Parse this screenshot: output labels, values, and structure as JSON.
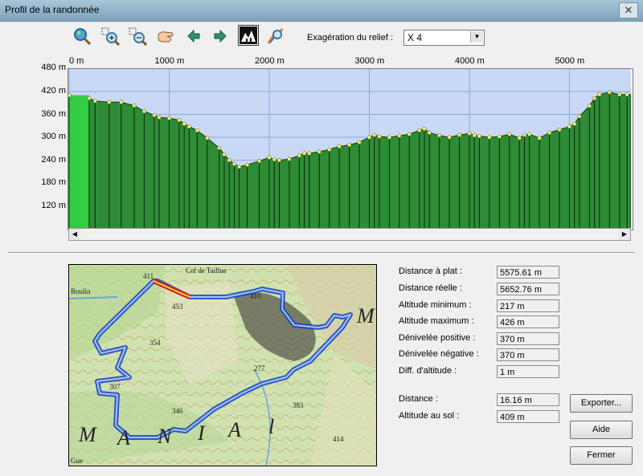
{
  "window": {
    "title": "Profil de la randonnée",
    "close_label": "✕"
  },
  "toolbar": {
    "icons": [
      "zoom-globe-icon",
      "zoom-in-icon",
      "zoom-out-icon",
      "hand-pan-icon",
      "arrow-left-icon",
      "arrow-right-icon",
      "terrain-profile-icon",
      "search-path-icon"
    ],
    "exaggeration_label": "Exagération du relief :",
    "exaggeration_value": "X 4"
  },
  "chart_data": {
    "type": "area",
    "x_ticks": [
      "0 m",
      "1000 m",
      "2000 m",
      "3000 m",
      "4000 m",
      "5000 m"
    ],
    "y_ticks": [
      "480 m",
      "420 m",
      "360 m",
      "300 m",
      "240 m",
      "180 m",
      "120 m"
    ],
    "xlim": [
      0,
      5575
    ],
    "ylim": [
      90,
      500
    ],
    "xlabel": "",
    "ylabel": "",
    "grid": true,
    "colors": {
      "sky": "#c8d8f5",
      "ground": "#2e8b36",
      "ground_start": "#33cc44",
      "grid": "#8ea8dc",
      "point": "#f3ef7a"
    },
    "x": [
      0,
      200,
      260,
      400,
      520,
      650,
      750,
      850,
      900,
      1000,
      1100,
      1150,
      1200,
      1280,
      1380,
      1500,
      1550,
      1600,
      1650,
      1700,
      1780,
      1900,
      2000,
      2050,
      2100,
      2200,
      2300,
      2350,
      2400,
      2500,
      2600,
      2700,
      2800,
      2900,
      3000,
      3050,
      3100,
      3200,
      3300,
      3400,
      3500,
      3550,
      3600,
      3700,
      3800,
      3900,
      4000,
      4050,
      4100,
      4200,
      4300,
      4400,
      4500,
      4550,
      4600,
      4700,
      4800,
      4900,
      5000,
      5050,
      5100,
      5200,
      5250,
      5300,
      5400,
      5500,
      5575
    ],
    "y": [
      410,
      402,
      395,
      392,
      392,
      383,
      368,
      358,
      352,
      350,
      345,
      335,
      328,
      318,
      298,
      272,
      255,
      240,
      230,
      223,
      228,
      238,
      247,
      242,
      240,
      243,
      252,
      258,
      258,
      262,
      268,
      276,
      280,
      287,
      300,
      306,
      302,
      300,
      304,
      308,
      318,
      322,
      312,
      305,
      300,
      306,
      310,
      305,
      303,
      300,
      302,
      308,
      298,
      306,
      308,
      298,
      312,
      320,
      328,
      335,
      355,
      382,
      402,
      412,
      418,
      412,
      412
    ]
  },
  "map": {
    "labels": [
      "Col de Taillue",
      "Boulin",
      "M",
      "A",
      "N",
      "I",
      "A",
      "l",
      "M",
      "411",
      "453",
      "410",
      "354",
      "277",
      "307",
      "346",
      "383",
      "414",
      "Gue"
    ]
  },
  "stats": [
    {
      "label": "Distance à plat :",
      "value": "5575.61 m"
    },
    {
      "label": "Distance réelle :",
      "value": "5652.76 m"
    },
    {
      "label": "Altitude minimum :",
      "value": "217 m"
    },
    {
      "label": "Altitude maximum :",
      "value": "426 m"
    },
    {
      "label": "Dénivelée positive :",
      "value": "370 m"
    },
    {
      "label": "Dénivelée négative :",
      "value": "370 m"
    },
    {
      "label": "Diff. d'altitude :",
      "value": "1 m"
    }
  ],
  "cursor": [
    {
      "label": "Distance :",
      "value": "16.16 m"
    },
    {
      "label": "Altitude au sol :",
      "value": "409 m"
    }
  ],
  "buttons": {
    "export": "Exporter...",
    "help": "Aide",
    "close": "Fermer"
  }
}
